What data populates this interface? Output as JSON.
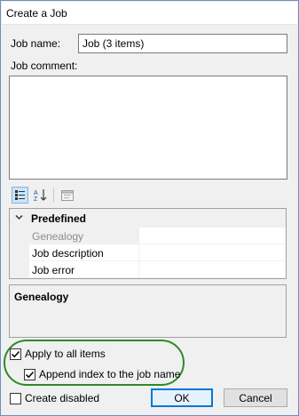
{
  "window": {
    "title": "Create a Job"
  },
  "form": {
    "job_name_label": "Job name:",
    "job_name_value": "Job (3 items)",
    "job_comment_label": "Job comment:",
    "job_comment_value": ""
  },
  "toolbar": {
    "categorized_icon": "categorized-view-icon",
    "alphabetical_icon": "alphabetical-sort-icon",
    "property_pages_icon": "property-pages-icon"
  },
  "property_grid": {
    "category": "Predefined",
    "properties": [
      {
        "name": "Genealogy",
        "value": ""
      },
      {
        "name": "Job description",
        "value": ""
      },
      {
        "name": "Job error",
        "value": ""
      }
    ]
  },
  "description_panel": {
    "title": "Genealogy"
  },
  "options": {
    "apply_to_all": {
      "label": "Apply to all items",
      "checked": true
    },
    "append_index": {
      "label": "Append index to the job name",
      "checked": true
    },
    "create_disabled": {
      "label": "Create disabled",
      "checked": false
    }
  },
  "buttons": {
    "ok": "OK",
    "cancel": "Cancel"
  },
  "colors": {
    "highlight": "#2f8a25",
    "accent": "#0078d7"
  }
}
